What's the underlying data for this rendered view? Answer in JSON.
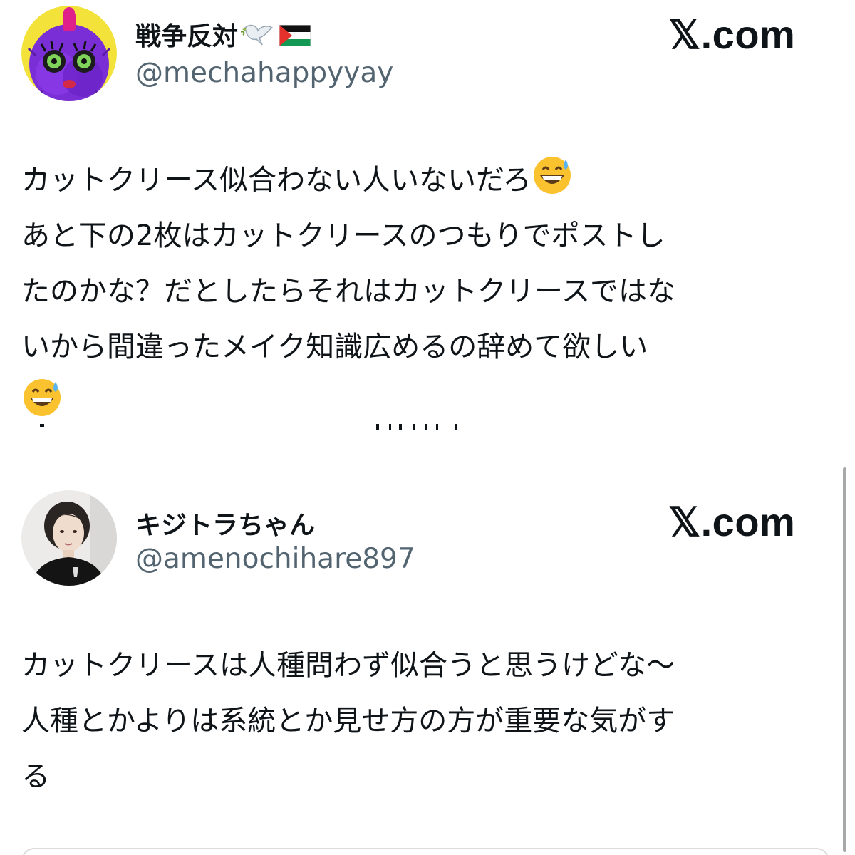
{
  "posts": [
    {
      "display_name": "戦争反対",
      "name_icons": [
        "dove-icon",
        "palestine-flag-icon"
      ],
      "handle": "@mechahappyyay",
      "brand": "𝕏.com",
      "text_lines": [
        "カットクリース似合わない人いないだろ",
        "あと下の2枚はカットクリースのつもりでポストし",
        "たのかな？だとしたらそれはカットクリースではな",
        "いから間違ったメイク知識広めるの辞めて欲しい"
      ],
      "emoji": "grinning-sweat-emoji",
      "avatar_icon": "purple-monster-avatar"
    },
    {
      "display_name": "キジトラちゃん",
      "handle": "@amenochihare897",
      "brand": "𝕏.com",
      "text_lines": [
        "カットクリースは人種問わず似合うと思うけどな〜",
        "人種とかよりは系統とか見せ方の方が重要な気がす",
        "る"
      ],
      "avatar_icon": "person-photo-avatar"
    }
  ],
  "colors": {
    "text": "#0f1419",
    "handle": "#536471",
    "background": "#ffffff"
  }
}
